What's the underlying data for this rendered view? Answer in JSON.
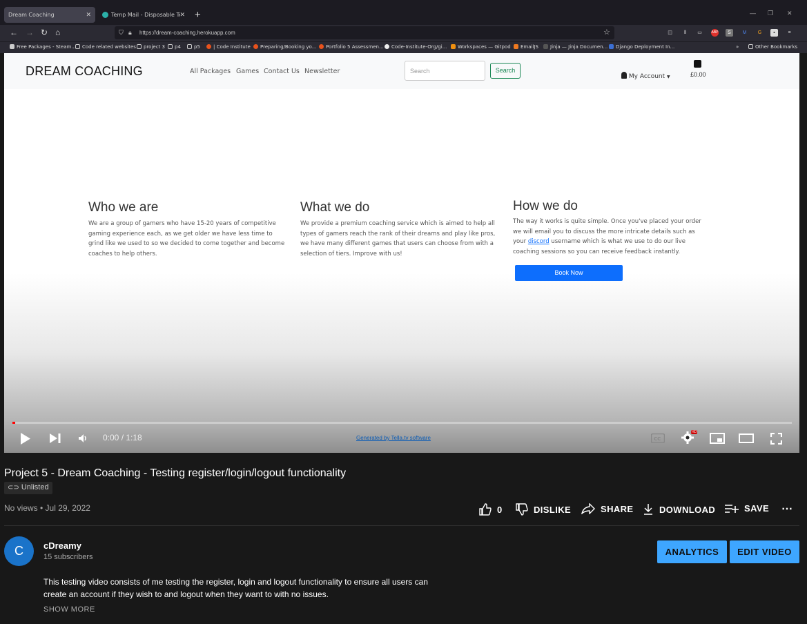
{
  "browser": {
    "tabs": [
      {
        "label": "Dream Coaching",
        "active": true
      },
      {
        "label": "Temp Mail - Disposable Tempo",
        "active": false
      }
    ],
    "url": "https://dream-coaching.herokuapp.com",
    "bookmarks": [
      "Free Packages - Steam...",
      "Code related websites",
      "project 3",
      "p4",
      "p5",
      "| Code Institute",
      "Preparing/Booking yo...",
      "Portfolio 5 Assessmen...",
      "Code-Institute-Org/gi...",
      "Workspaces — Gitpod",
      "EmailJS",
      "Jinja — Jinja Documen...",
      "Django Deployment In...",
      "Other Bookmarks"
    ]
  },
  "site": {
    "brand": "DREAM COACHING",
    "nav": [
      "All Packages",
      "Games",
      "Contact Us",
      "Newsletter"
    ],
    "search_placeholder": "Search",
    "search_button": "Search",
    "my_account": "My Account",
    "price": "£0.00",
    "columns": [
      {
        "heading": "Who we are",
        "text": "We are a group of gamers who have 15-20 years of competitive gaming experience each, as we get older we have less time to grind like we used to so we decided to come together and become coaches to help others."
      },
      {
        "heading": "What we do",
        "text": "We provide a premium coaching service which is aimed to help all types of gamers reach the rank of their dreams and play like pros, we have many different games that users can choose from with a selection of tiers. Improve with us!"
      },
      {
        "heading": "How we do",
        "text_before": "The way it works is quite simple. Once you've placed your order we will email you to discuss the more intricate details such as your ",
        "link": "discord",
        "text_after": " username which is what we use to do our live coaching sessions so you can receive feedback instantly."
      }
    ],
    "book_now": "Book Now"
  },
  "player": {
    "time": "0:00 / 1:18",
    "progress": 0.0,
    "hd_badge": "HD",
    "overlay_link": "Generated by Tella.tv software"
  },
  "video": {
    "title": "Project 5 - Dream Coaching - Testing register/login/logout functionality",
    "visibility": "Unlisted",
    "meta": "No views • Jul 29, 2022",
    "likes": "0",
    "actions": {
      "dislike": "DISLIKE",
      "share": "SHARE",
      "download": "DOWNLOAD",
      "save": "SAVE"
    },
    "channel": {
      "avatar_letter": "C",
      "name": "cDreamy",
      "subscribers": "15 subscribers"
    },
    "buttons": {
      "analytics": "ANALYTICS",
      "edit": "EDIT VIDEO"
    },
    "description": "This testing video consists of me testing the register, login and logout functionality to ensure all users can create an account if they wish to and logout when they want to with no issues.",
    "show_more": "SHOW MORE"
  },
  "colors": {
    "youtube_bg": "#181818",
    "accent_blue": "#3ea6ff",
    "progress_red": "#ff0000",
    "site_primary": "#0d6efd",
    "site_success": "#198754"
  }
}
